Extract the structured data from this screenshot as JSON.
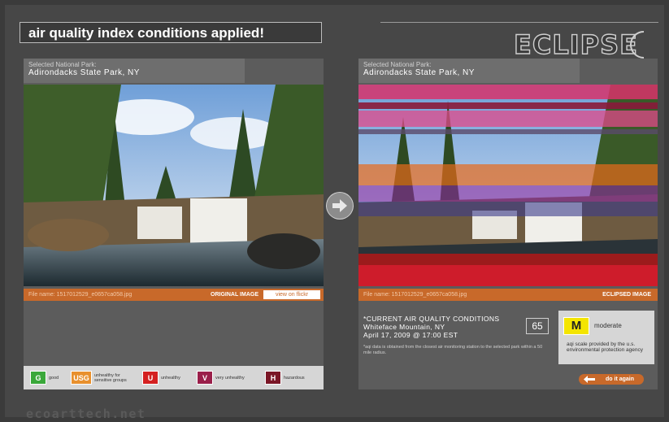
{
  "banner": {
    "text": "air quality index conditions applied!"
  },
  "logo": {
    "text": "ECLIPSE"
  },
  "left": {
    "park_label": "Selected National Park:",
    "park_name": "Adirondacks State Park, NY",
    "file_name": "File name: 1517012529_e0657ca058.jpg",
    "tag": "ORIGINAL IMAGE",
    "flickr": "view on flickr"
  },
  "right": {
    "park_label": "Selected National Park:",
    "park_name": "Adirondacks State Park, NY",
    "file_name": "File name: 1517012529_e0657ca058.jpg",
    "tag": "ECLIPSED IMAGE"
  },
  "legend": [
    {
      "code": "G",
      "label": "good",
      "color": "#3aa83a"
    },
    {
      "code": "USG",
      "label": "unhealthy for sensitive groups",
      "color": "#e8902e"
    },
    {
      "code": "U",
      "label": "unhealthy",
      "color": "#d42020"
    },
    {
      "code": "V",
      "label": "very unhealthy",
      "color": "#9a1f4a"
    },
    {
      "code": "H",
      "label": "hazardous",
      "color": "#7a1626"
    }
  ],
  "conditions": {
    "title": "*CURRENT AIR QUALITY CONDITIONS",
    "location": "Whiteface Mountain, NY",
    "datetime": "April 17, 2009 @ 17:00 EST",
    "note": "*aqi data is obtained from the closest air monitoring station to the selected park within a 50 mile radius.",
    "aqi_value": "65"
  },
  "scale": {
    "level_code": "M",
    "level_label": "moderate",
    "note": "aqi scale provided by the u.s. environmental protection agency"
  },
  "actions": {
    "again": "do it again"
  },
  "footer": {
    "text": "ecoarttech.net"
  },
  "colors": {
    "accent": "#c8692a",
    "moderate": "#f4e500"
  }
}
